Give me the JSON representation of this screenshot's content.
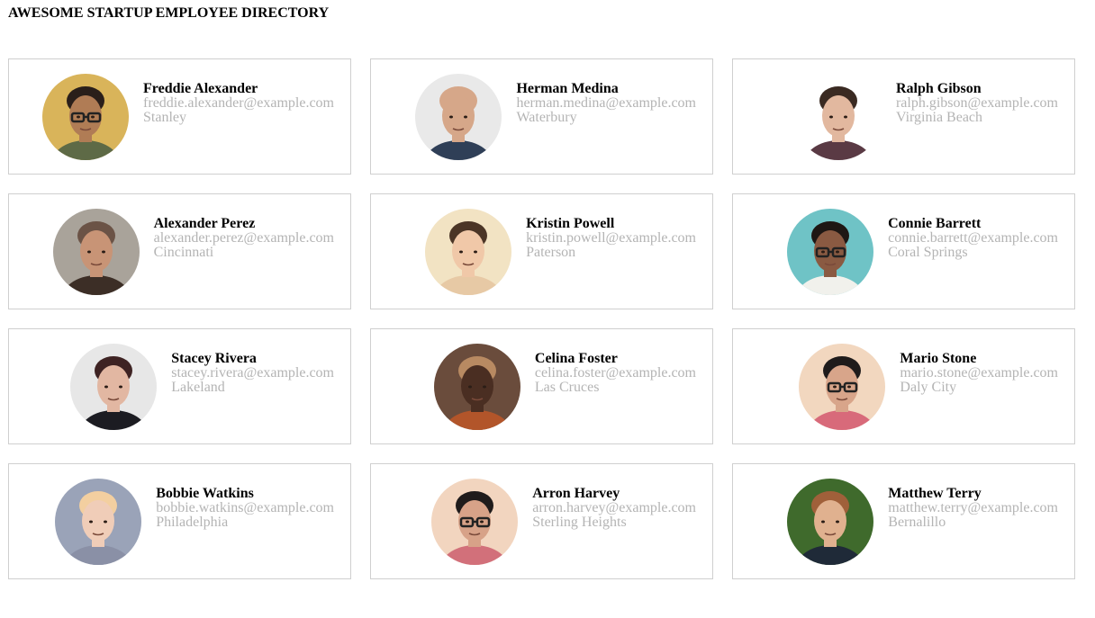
{
  "page": {
    "title": "AWESOME STARTUP EMPLOYEE DIRECTORY"
  },
  "employees": [
    {
      "name": "Freddie Alexander",
      "email": "freddie.alexander@example.com",
      "city": "Stanley",
      "avatar": {
        "bg": "#d9b45a",
        "skin": "#b07c55",
        "hair": "#2a1f1a",
        "shirt": "#5e6a46",
        "glasses": true
      }
    },
    {
      "name": "Herman Medina",
      "email": "herman.medina@example.com",
      "city": "Waterbury",
      "avatar": {
        "bg": "#e9e9e9",
        "skin": "#d6a789",
        "hair": "#d6a789",
        "shirt": "#2f3f57",
        "glasses": false
      }
    },
    {
      "name": "Ralph Gibson",
      "email": "ralph.gibson@example.com",
      "city": "Virginia Beach",
      "avatar": {
        "bg": "#ffffff",
        "skin": "#e2b89f",
        "hair": "#3a2a22",
        "shirt": "#5a3a44",
        "glasses": false
      }
    },
    {
      "name": "Alexander Perez",
      "email": "alexander.perez@example.com",
      "city": "Cincinnati",
      "avatar": {
        "bg": "#a9a39a",
        "skin": "#c89476",
        "hair": "#6b5346",
        "shirt": "#3c2e26",
        "glasses": false
      }
    },
    {
      "name": "Kristin Powell",
      "email": "kristin.powell@example.com",
      "city": "Paterson",
      "avatar": {
        "bg": "#f2e3c3",
        "skin": "#f0c8a8",
        "hair": "#4b3526",
        "shirt": "#e7c9a5",
        "glasses": false
      }
    },
    {
      "name": "Connie Barrett",
      "email": "connie.barrett@example.com",
      "city": "Coral Springs",
      "avatar": {
        "bg": "#6fc3c6",
        "skin": "#8a5a42",
        "hair": "#1e1714",
        "shirt": "#f1f1ec",
        "glasses": true
      }
    },
    {
      "name": "Stacey Rivera",
      "email": "stacey.rivera@example.com",
      "city": "Lakeland",
      "avatar": {
        "bg": "#e7e7e7",
        "skin": "#e2b7a2",
        "hair": "#3e2323",
        "shirt": "#1c1c22",
        "glasses": false
      }
    },
    {
      "name": "Celina Foster",
      "email": "celina.foster@example.com",
      "city": "Las Cruces",
      "avatar": {
        "bg": "#6a4c3c",
        "skin": "#4a2e22",
        "hair": "#b88a62",
        "shirt": "#b2552a",
        "glasses": false
      }
    },
    {
      "name": "Mario Stone",
      "email": "mario.stone@example.com",
      "city": "Daly City",
      "avatar": {
        "bg": "#f2d7bf",
        "skin": "#d8a58a",
        "hair": "#1f1b1b",
        "shirt": "#d86a7a",
        "glasses": true
      }
    },
    {
      "name": "Bobbie Watkins",
      "email": "bobbie.watkins@example.com",
      "city": "Philadelphia",
      "avatar": {
        "bg": "#9aa3b8",
        "skin": "#f0cdb8",
        "hair": "#f3cfa0",
        "shirt": "#8a90a6",
        "glasses": false
      }
    },
    {
      "name": "Arron Harvey",
      "email": "arron.harvey@example.com",
      "city": "Sterling Heights",
      "avatar": {
        "bg": "#f2d5bf",
        "skin": "#d7a288",
        "hair": "#1f1b1b",
        "shirt": "#d2707a",
        "glasses": true
      }
    },
    {
      "name": "Matthew Terry",
      "email": "matthew.terry@example.com",
      "city": "Bernalillo",
      "avatar": {
        "bg": "#3f6a2c",
        "skin": "#e0b18f",
        "hair": "#a0603a",
        "shirt": "#1f2a38",
        "glasses": false
      }
    }
  ]
}
